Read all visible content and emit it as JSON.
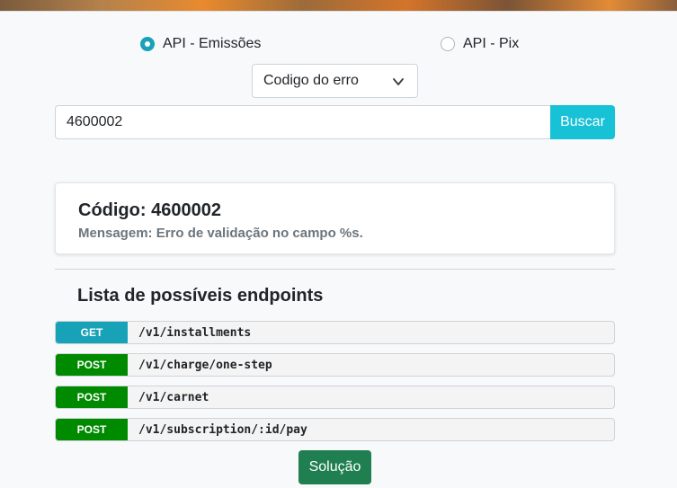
{
  "api_selector": {
    "options": [
      {
        "label": "API - Emissões",
        "checked": true
      },
      {
        "label": "API - Pix",
        "checked": false
      }
    ]
  },
  "search_type": {
    "selected": "Codigo do erro",
    "icon": "chevron-down-icon"
  },
  "search": {
    "value": "4600002",
    "button_label": "Buscar"
  },
  "result": {
    "code_line": "Código: 4600002",
    "message_line": "Mensagem: Erro de validação no campo %s."
  },
  "endpoints": {
    "title": "Lista de possíveis endpoints",
    "items": [
      {
        "method": "GET",
        "path": "/v1/installments",
        "color": "#17a2b8"
      },
      {
        "method": "POST",
        "path": "/v1/charge/one-step",
        "color": "#008a00"
      },
      {
        "method": "POST",
        "path": "/v1/carnet",
        "color": "#008a00"
      },
      {
        "method": "POST",
        "path": "/v1/subscription/:id/pay",
        "color": "#008a00"
      }
    ]
  },
  "solution_button": {
    "label": "Solução"
  },
  "colors": {
    "accent": "#17a2b8",
    "search_button": "#17c1d6",
    "solution_button": "#1f7f51",
    "post": "#008a00"
  }
}
